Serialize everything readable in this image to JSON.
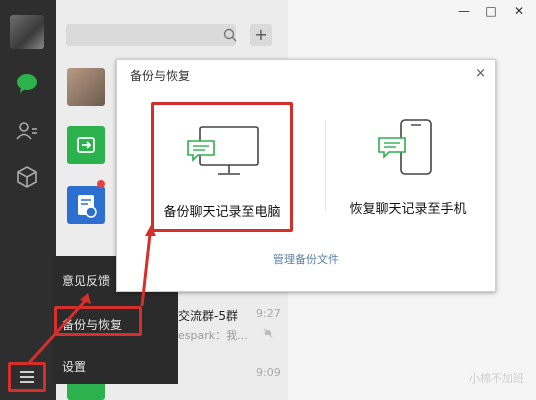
{
  "dialog": {
    "title": "备份与恢复",
    "close_label": "×",
    "option_backup_pc": "备份聊天记录至电脑",
    "option_restore_phone": "恢复聊天记录至手机",
    "manage_link": "管理备份文件"
  },
  "menu": {
    "items": [
      {
        "label": "意见反馈"
      },
      {
        "label": "备份与恢复"
      },
      {
        "label": "设置"
      }
    ]
  },
  "chatlist": {
    "add_label": "+",
    "fragments": [
      {
        "text": "交流群-5群"
      },
      {
        "text": "espark：我..."
      },
      {
        "text": "9:27"
      },
      {
        "text": "9:09"
      }
    ]
  },
  "window": {
    "minimize": "—",
    "maximize": "□",
    "close": "✕"
  },
  "watermark": "小棉不加班",
  "colors": {
    "highlight": "#d52f2b",
    "wechat_green": "#2bb24c",
    "link": "#5b7fa6"
  }
}
